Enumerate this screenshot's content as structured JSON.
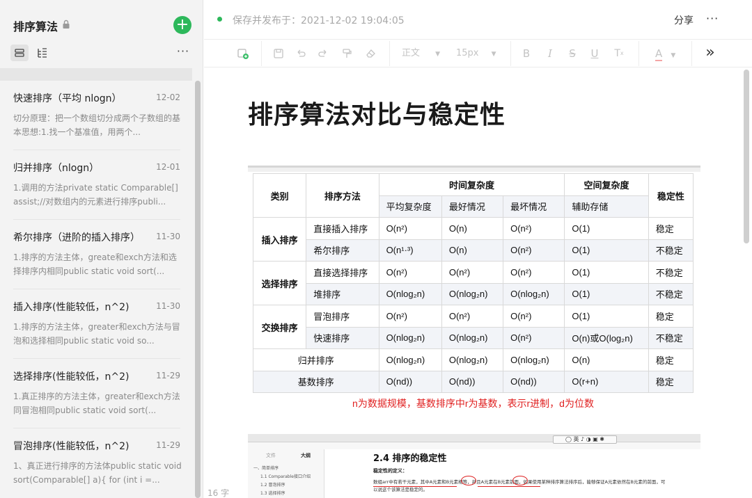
{
  "sidebar": {
    "notebook_title": "排序算法",
    "add_label": "+",
    "more_label": "···",
    "notes": [
      {
        "title": "快速排序（平均 nlogn）",
        "date": "12-02",
        "summary": "切分原理：把一个数组切分成两个子数组的基本思想:1.找一个基准值，用两个..."
      },
      {
        "title": "归并排序（nlogn）",
        "date": "12-01",
        "summary": "1.调用的方法private static Comparable[] assist;//对数组内的元素进行排序publi..."
      },
      {
        "title": "希尔排序（进阶的插入排序）",
        "date": "11-30",
        "summary": "1.排序的方法主体，greate和exch方法和选择排序内相同public static void sort(..."
      },
      {
        "title": "插入排序(性能较低，n^2)",
        "date": "11-30",
        "summary": "1.排序的方法主体，greater和exch方法与冒泡和选择相同public static void so..."
      },
      {
        "title": "选择排序(性能较低，n^2)",
        "date": "11-29",
        "summary": "1.真正排序的方法主体，greater和exch方法同冒泡相同public static void sort(..."
      },
      {
        "title": "冒泡排序(性能较低，n^2)",
        "date": "11-29",
        "summary": "1、真正进行排序的方法体public static void sort(Comparable[] a){    for (int i =..."
      }
    ]
  },
  "header": {
    "save_status": "保存并发布于：2021-12-02 19:04:05",
    "share_label": "分享",
    "more_label": "···"
  },
  "toolbar": {
    "paragraph_label": "正文",
    "font_size_label": "15px",
    "bold": "B",
    "italic": "I",
    "strike": "S",
    "underline": "U",
    "superscript": "T",
    "font_color": "A",
    "expand": "»"
  },
  "document": {
    "title": "排序算法对比与稳定性",
    "word_count": "16 字"
  },
  "table": {
    "headers": {
      "category": "类别",
      "method": "排序方法",
      "time": "时间复杂度",
      "space": "空间复杂度",
      "stability": "稳定性",
      "avg": "平均复杂度",
      "best": "最好情况",
      "worst": "最坏情况",
      "aux": "辅助存储"
    },
    "groups": [
      {
        "category": "插入排序",
        "rows": [
          {
            "method": "直接插入排序",
            "avg": "O(n²)",
            "best": "O(n)",
            "worst": "O(n²)",
            "space": "O(1)",
            "stable": "稳定"
          },
          {
            "method": "希尔排序",
            "avg": "O(n¹·³)",
            "best": "O(n)",
            "worst": "O(n²)",
            "space": "O(1)",
            "stable": "不稳定"
          }
        ]
      },
      {
        "category": "选择排序",
        "rows": [
          {
            "method": "直接选择排序",
            "avg": "O(n²)",
            "best": "O(n²)",
            "worst": "O(n²)",
            "space": "O(1)",
            "stable": "不稳定"
          },
          {
            "method": "堆排序",
            "avg": "O(nlog₂n)",
            "best": "O(nlog₂n)",
            "worst": "O(nlog₂n)",
            "space": "O(1)",
            "stable": "不稳定"
          }
        ]
      },
      {
        "category": "交换排序",
        "rows": [
          {
            "method": "冒泡排序",
            "avg": "O(n²)",
            "best": "O(n²)",
            "worst": "O(n²)",
            "space": "O(1)",
            "stable": "稳定"
          },
          {
            "method": "快速排序",
            "avg": "O(nlog₂n)",
            "best": "O(nlog₂n)",
            "worst": "O(n²)",
            "space": "O(n)或O(log₂n)",
            "stable": "不稳定"
          }
        ]
      }
    ],
    "merged_rows": [
      {
        "method": "归并排序",
        "avg": "O(nlog₂n)",
        "best": "O(nlog₂n)",
        "worst": "O(nlog₂n)",
        "space": "O(n)",
        "stable": "稳定"
      },
      {
        "method": "基数排序",
        "avg": "O(nd))",
        "best": "O(nd))",
        "worst": "O(nd))",
        "space": "O(r+n)",
        "stable": "稳定"
      }
    ],
    "note": "n为数据规模，基数排序中r为基数，表示r进制，d为位数"
  },
  "screenshot2": {
    "float_toolbar": "◯ 英 ♪ ◑ ▣ ✱",
    "tab_files": "文件",
    "tab_outline": "大纲",
    "outline_items": [
      "一、简单排序",
      "1.1 Comparable接口介绍",
      "1.2 冒泡排序",
      "1.3 选择排序"
    ],
    "heading": "2.4 排序的稳定性",
    "def_label": "稳定性的定义：",
    "text": "数组arr中有若干元素，其中A元素和B元素相等，并且A元素在B元素前面，如果使用某种排序算法排序后，能够保证A元素依然在B元素的前面，可以说这个该算法是稳定的。"
  },
  "colors": {
    "accent_green": "#2db85b",
    "note_red": "#e02020"
  }
}
